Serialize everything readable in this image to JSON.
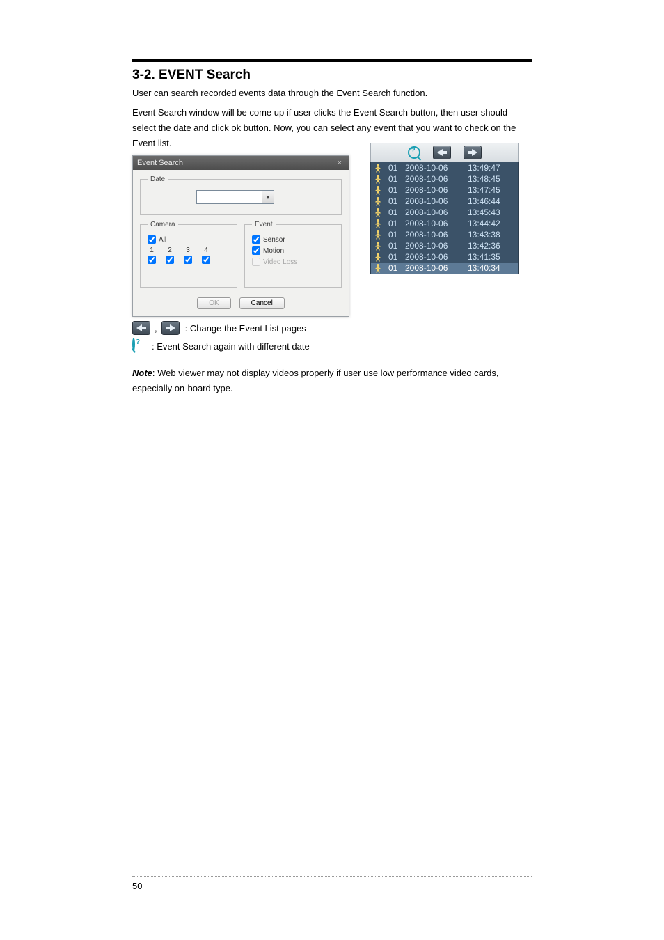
{
  "section_title": "3-2. EVENT Search",
  "intro_p": [
    "User can search recorded events data through the Event Search function.",
    "Event Search window will be come up if user clicks the Event Search button, then user should select the date and click ok button. Now, you can select any event that you want to check on the Event list."
  ],
  "dialog": {
    "title": "Event Search",
    "close_glyph": "×",
    "fieldsets": {
      "date": {
        "legend": "Date"
      },
      "camera": {
        "legend": "Camera",
        "all_label": "All",
        "channels": [
          "1",
          "2",
          "3",
          "4"
        ]
      },
      "event": {
        "legend": "Event",
        "sensor": "Sensor",
        "motion": "Motion",
        "video_loss": "Video Loss"
      }
    },
    "buttons": {
      "ok": "OK",
      "cancel": "Cancel"
    }
  },
  "event_list": {
    "rows": [
      {
        "ch": "01",
        "date": "2008-10-06",
        "time": "13:49:47",
        "selected": false
      },
      {
        "ch": "01",
        "date": "2008-10-06",
        "time": "13:48:45",
        "selected": false
      },
      {
        "ch": "01",
        "date": "2008-10-06",
        "time": "13:47:45",
        "selected": false
      },
      {
        "ch": "01",
        "date": "2008-10-06",
        "time": "13:46:44",
        "selected": false
      },
      {
        "ch": "01",
        "date": "2008-10-06",
        "time": "13:45:43",
        "selected": false
      },
      {
        "ch": "01",
        "date": "2008-10-06",
        "time": "13:44:42",
        "selected": false
      },
      {
        "ch": "01",
        "date": "2008-10-06",
        "time": "13:43:38",
        "selected": false
      },
      {
        "ch": "01",
        "date": "2008-10-06",
        "time": "13:42:36",
        "selected": false
      },
      {
        "ch": "01",
        "date": "2008-10-06",
        "time": "13:41:35",
        "selected": false
      },
      {
        "ch": "01",
        "date": "2008-10-06",
        "time": "13:40:34",
        "selected": true
      }
    ]
  },
  "legends": {
    "arrows": ": Change the Event List pages",
    "search": ": Event Search again with different date"
  },
  "note": {
    "label": "Note",
    "text": ": Web viewer may not display videos properly if user use low performance video cards, especially on-board type."
  },
  "page_number": "50"
}
